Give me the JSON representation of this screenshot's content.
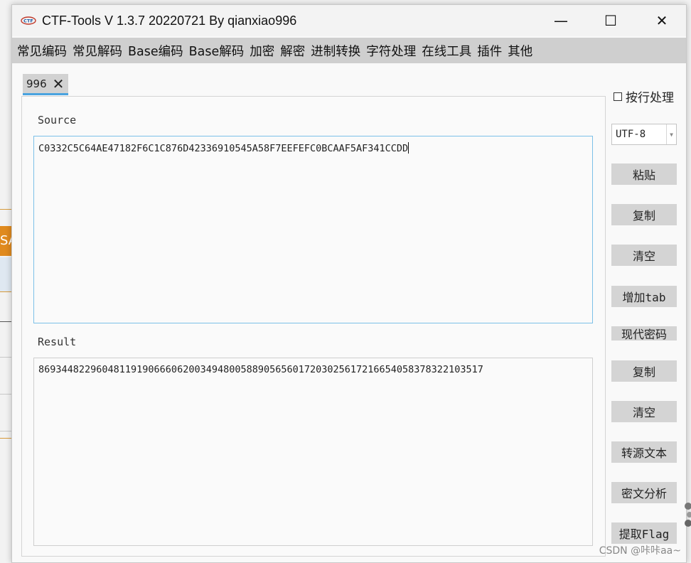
{
  "window": {
    "title": "CTF-Tools V 1.3.7 20220721 By qianxiao996",
    "minimize_glyph": "—",
    "maximize_glyph": "☐",
    "close_glyph": "✕",
    "app_icon_text": "CTF"
  },
  "menu": {
    "items": [
      "常见编码",
      "常见解码",
      "Base编码",
      "Base解码",
      "加密",
      "解密",
      "进制转换",
      "字符处理",
      "在线工具",
      "插件",
      "其他"
    ]
  },
  "tab": {
    "label": "996",
    "close_glyph": "✕"
  },
  "source": {
    "label": "Source",
    "value": "C0332C5C64AE47182F6C1C876D42336910545A58F7EEFEFC0BCAAF5AF341CCDD"
  },
  "result": {
    "label": "Result",
    "value": "869344822960481191906660620034948005889056560172030256172166540583783221035​17"
  },
  "side": {
    "line_mode_label": "按行处理",
    "encoding": "UTF-8",
    "buttons": {
      "paste": "粘贴",
      "copy_source": "复制",
      "clear_source": "清空",
      "add_tab": "增加tab",
      "modern_crypto": "现代密码",
      "copy_result": "复制",
      "clear_result": "清空",
      "to_source": "转源文本",
      "cipher_analysis": "密文分析",
      "extract_flag": "提取Flag"
    }
  },
  "watermark": "CSDN @咔咔aa~",
  "background": {
    "partial_text": "SA"
  }
}
